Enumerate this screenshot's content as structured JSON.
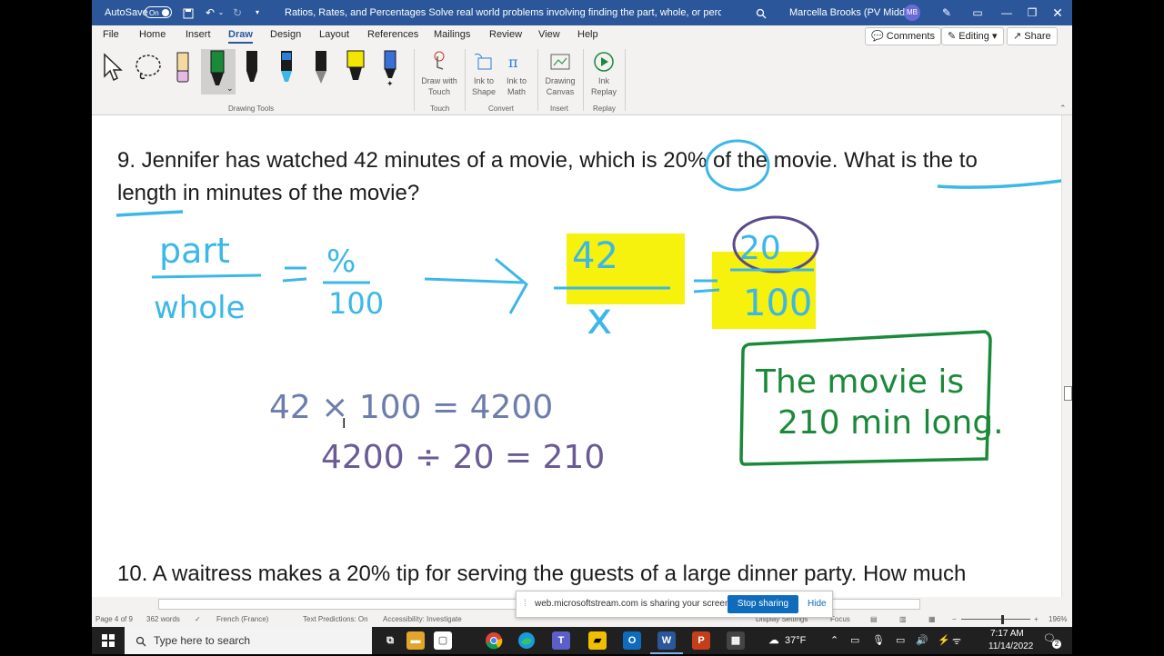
{
  "titlebar": {
    "autosave_label": "AutoSave",
    "autosave_state": "On",
    "document_title": "Ratios, Rates, and Percentages Solve real world problems involving finding the part, whole, or percent • Saving...",
    "user_name": "Marcella Brooks (PV Middle)",
    "user_initials": "MB"
  },
  "menu": {
    "tabs": [
      "File",
      "Home",
      "Insert",
      "Draw",
      "Design",
      "Layout",
      "References",
      "Mailings",
      "Review",
      "View",
      "Help"
    ],
    "active_tab": "Draw",
    "comments_label": "Comments",
    "editing_label": "Editing",
    "share_label": "Share"
  },
  "ribbon": {
    "groups": {
      "drawing_tools": "Drawing Tools",
      "touch": "Touch",
      "convert": "Convert",
      "insert": "Insert",
      "replay": "Replay"
    },
    "buttons": {
      "draw_with_touch": [
        "Draw with",
        "Touch"
      ],
      "ink_to_shape": [
        "Ink to",
        "Shape"
      ],
      "ink_to_math": [
        "Ink to",
        "Math"
      ],
      "drawing_canvas": [
        "Drawing",
        "Canvas"
      ],
      "ink_replay": [
        "Ink",
        "Replay"
      ]
    },
    "pen_colors": [
      "#1b1b1b",
      "#1b1b1b",
      "#2b7fd6",
      "#1b1b1b",
      "#f5e600",
      "#3a6fd8"
    ]
  },
  "document": {
    "q9_line1": "9. Jennifer has watched 42 minutes of a movie, which is 20% of the movie.  What is the to",
    "q9_line2": "length in minutes of the movie?",
    "q10_line1": "10. A waitress makes a 20% tip for serving the guests of a large dinner party.  How much",
    "ink": {
      "part": "part",
      "whole": "whole",
      "percent": "%",
      "hundred": "100",
      "n42": "42",
      "x": "x",
      "n20": "20",
      "n100": "100",
      "calc1": "42 × 100 = 4200",
      "calc2": "4200 ÷ 20 = 210",
      "answer_line1": "The movie is",
      "answer_line2": "210 min long."
    }
  },
  "share_notice": {
    "text": "web.microsoftstream.com is sharing your screen.",
    "stop_label": "Stop sharing",
    "hide_label": "Hide"
  },
  "status": {
    "page": "Page 4 of 9",
    "words": "362 words",
    "language": "French (France)",
    "text_predictions": "Text Predictions: On",
    "accessibility": "Accessibility: Investigate",
    "display_settings": "Display Settings",
    "focus": "Focus",
    "zoom": "196%"
  },
  "taskbar": {
    "search_placeholder": "Type here to search",
    "temperature": "37°F",
    "time": "7:17 AM",
    "date": "11/14/2022",
    "notification_count": "2"
  },
  "colors": {
    "word_blue": "#2b579a",
    "ink_cyan": "#3bb7e8",
    "highlight_yellow": "#f5f000",
    "ink_green": "#1a8a3a",
    "ink_purple": "#5b4a8a"
  }
}
